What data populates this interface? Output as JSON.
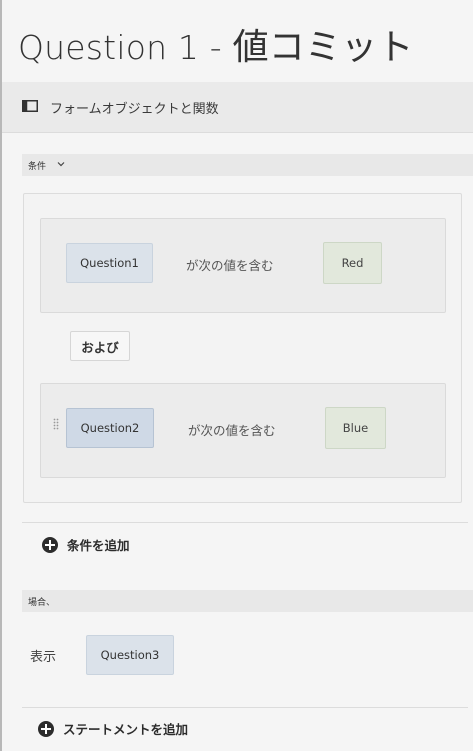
{
  "title": {
    "prefix": "Question 1 - ",
    "suffix": "値コミット"
  },
  "objbar": {
    "label": "フォームオブジェクトと関数",
    "icon": "panel-toggle-icon"
  },
  "condition": {
    "header": "条件",
    "rows": [
      {
        "field": "Question1",
        "operator": "が次の値を含む",
        "value": "Red"
      },
      {
        "field": "Question2",
        "operator": "が次の値を含む",
        "value": "Blue"
      }
    ],
    "joiner": "および",
    "add_label": "条件を追加"
  },
  "then": {
    "header": "場合、",
    "action": "表示",
    "target": "Question3",
    "add_label": "ステートメントを追加"
  },
  "colors": {
    "field_chip": "#dbe2ea",
    "value_chip": "#e2e8dc",
    "background": "#f5f5f5"
  }
}
